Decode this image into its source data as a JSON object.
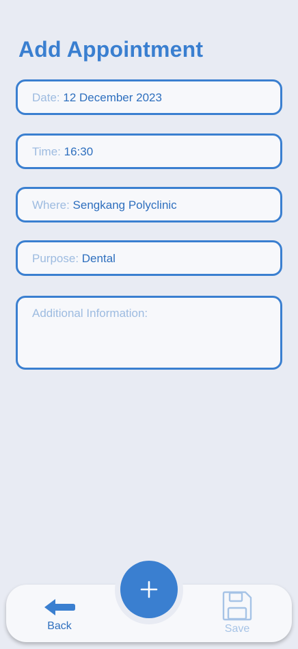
{
  "header": {
    "title": "Add Appointment"
  },
  "form": {
    "date": {
      "label": "Date:",
      "value": "12 December 2023"
    },
    "time": {
      "label": "Time:",
      "value": "16:30"
    },
    "where": {
      "label": "Where:",
      "value": "Sengkang Polyclinic"
    },
    "purpose": {
      "label": "Purpose:",
      "value": "Dental"
    },
    "additional": {
      "label": "Additional Information:",
      "value": ""
    }
  },
  "bottom_nav": {
    "back_label": "Back",
    "save_label": "Save",
    "add_icon": "plus-icon",
    "back_icon": "arrow-left-icon",
    "save_icon": "floppy-disk-icon"
  },
  "colors": {
    "accent": "#3a7fd0",
    "background": "#e8ebf3",
    "field_background": "#f7f8fb",
    "label_muted": "#9dbbe0",
    "value_text": "#2e6fbe",
    "disabled": "#a6c3e6"
  }
}
